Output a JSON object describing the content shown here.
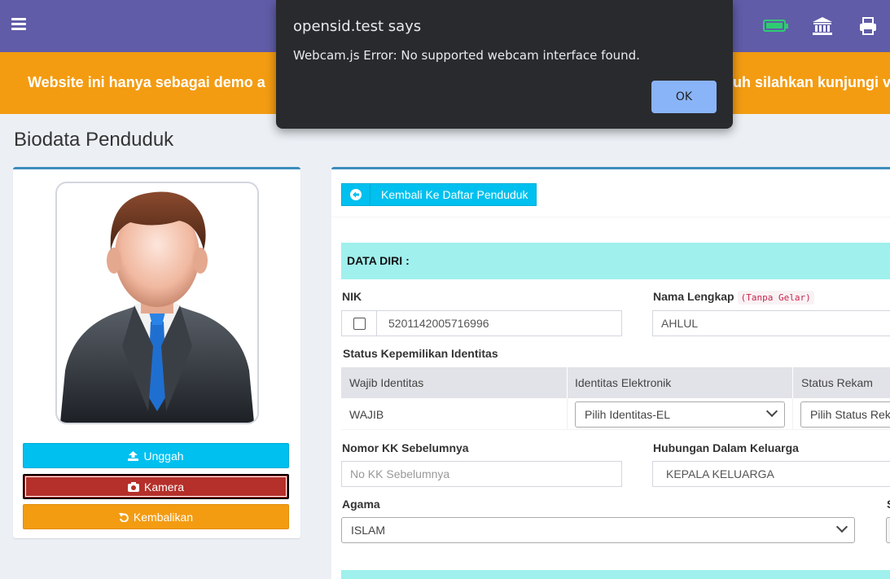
{
  "dialog": {
    "title": "opensid.test says",
    "message": "Webcam.js Error: No supported webcam interface found.",
    "ok_label": "OK"
  },
  "banner": {
    "text_left": "Website ini hanya sebagai demo a",
    "text_right": "uh silahkan kunjungi v"
  },
  "page": {
    "title": "Biodata Penduduk"
  },
  "left_panel": {
    "upload_label": "Unggah",
    "camera_label": "Kamera",
    "reset_label": "Kembalikan"
  },
  "form": {
    "back_label": "Kembali Ke Daftar Penduduk",
    "section_title": "DATA DIRI :",
    "nik_label": "NIK",
    "nik_value": "5201142005716996",
    "nama_label": "Nama Lengkap",
    "nama_hint": "(Tanpa Gelar)",
    "nama_value": "AHLUL",
    "status_identitas_label": "Status Kepemilikan Identitas",
    "identitas_headers": [
      "Wajib Identitas",
      "Identitas Elektronik",
      "Status Rekam"
    ],
    "wajib_value": "WAJIB",
    "identitas_el_value": "Pilih Identitas-EL",
    "status_rekam_value": "Pilih Status Reka",
    "kk_label": "Nomor KK Sebelumnya",
    "kk_placeholder": "No KK Sebelumnya",
    "hubungan_label": "Hubungan Dalam Keluarga",
    "hubungan_value": "KEPALA KELUARGA",
    "agama_label": "Agama",
    "agama_value": "ISLAM",
    "s_label": "S"
  },
  "colors": {
    "topbar": "#605ca8",
    "banner": "#f39c12",
    "info": "#00c0ef",
    "camera": "#b5302a",
    "section": "#a0f0ed"
  }
}
